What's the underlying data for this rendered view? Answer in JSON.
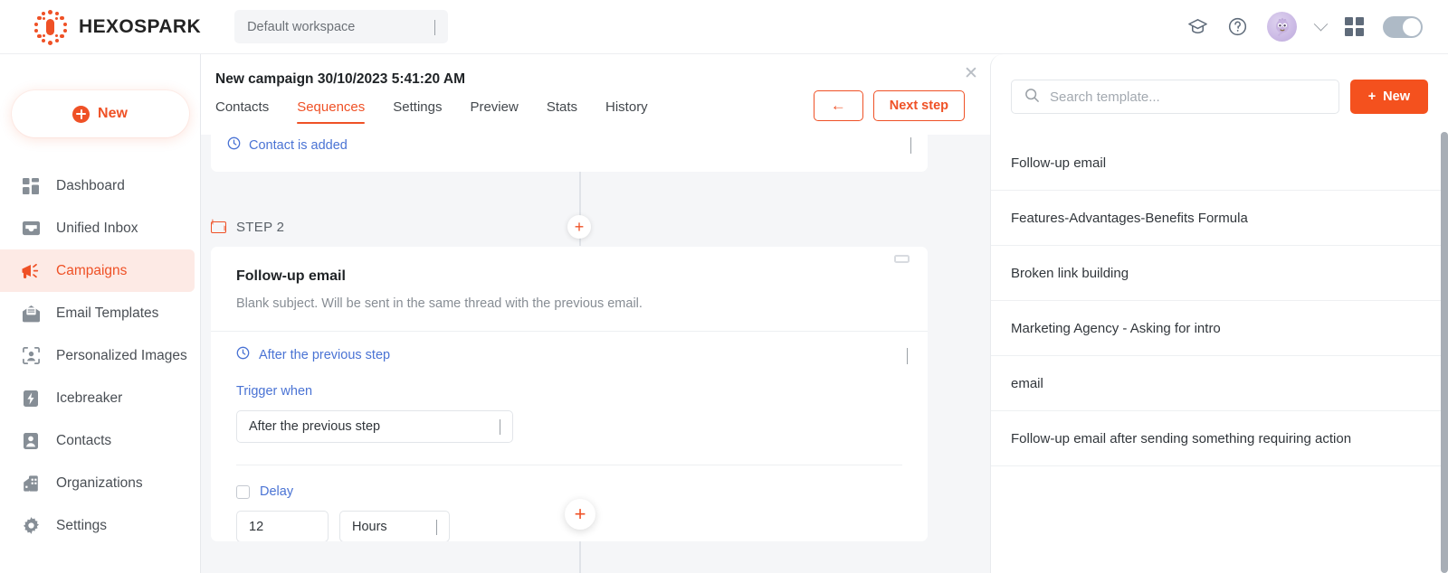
{
  "topbar": {
    "brand": "HEXOSPARK",
    "workspace": "Default workspace",
    "icons": {
      "education": "graduation-cap-icon",
      "help": "help-circle-icon",
      "avatar": "user-avatar",
      "chevron": "chevron-down-icon",
      "apps": "grid-apps-icon",
      "toggle": "theme-toggle"
    }
  },
  "sidebar": {
    "new_label": "New",
    "items": [
      {
        "label": "Dashboard",
        "icon": "dashboard-icon",
        "active": false
      },
      {
        "label": "Unified Inbox",
        "icon": "inbox-icon",
        "active": false
      },
      {
        "label": "Campaigns",
        "icon": "megaphone-icon",
        "active": true
      },
      {
        "label": "Email Templates",
        "icon": "email-template-icon",
        "active": false
      },
      {
        "label": "Personalized Images",
        "icon": "personalized-image-icon",
        "active": false
      },
      {
        "label": "Icebreaker",
        "icon": "lightning-icon",
        "active": false
      },
      {
        "label": "Contacts",
        "icon": "contact-icon",
        "active": false
      },
      {
        "label": "Organizations",
        "icon": "organization-icon",
        "active": false
      },
      {
        "label": "Settings",
        "icon": "gear-icon",
        "active": false
      }
    ]
  },
  "campaign": {
    "title": "New campaign 30/10/2023 5:41:20 AM",
    "tabs": [
      {
        "label": "Contacts",
        "active": false
      },
      {
        "label": "Sequences",
        "active": true
      },
      {
        "label": "Settings",
        "active": false
      },
      {
        "label": "Preview",
        "active": false
      },
      {
        "label": "Stats",
        "active": false
      },
      {
        "label": "History",
        "active": false
      }
    ],
    "back_label": "←",
    "next_label": "Next step",
    "close_label": "✕"
  },
  "sequence": {
    "previous_step_label": "Contact is added",
    "step_label": "STEP 2",
    "add_step_label": "+",
    "add_step_bottom_label": "+",
    "card": {
      "title": "Follow-up email",
      "subtitle": "Blank subject. Will be sent in the same thread with the previous email.",
      "trigger_header": "After the previous step",
      "trigger_field_label": "Trigger when",
      "trigger_value": "After the previous step",
      "delay_label": "Delay",
      "delay_value": "12",
      "delay_unit": "Hours"
    }
  },
  "templates": {
    "search_placeholder": "Search template...",
    "new_label": "New",
    "items": [
      {
        "label": "Follow-up email"
      },
      {
        "label": "Features-Advantages-Benefits Formula"
      },
      {
        "label": "Broken link building"
      },
      {
        "label": "Marketing Agency - Asking for intro"
      },
      {
        "label": "email"
      },
      {
        "label": "Follow-up email after sending something requiring action"
      }
    ]
  },
  "colors": {
    "brand_orange": "#ef5126",
    "accent_blue": "#4a73d4",
    "canvas_bg": "#f5f6f8"
  }
}
